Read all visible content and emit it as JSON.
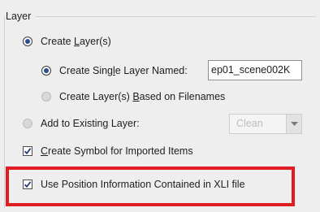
{
  "group": {
    "title": "Layer"
  },
  "options": {
    "create_layers": {
      "label_pre": "Create ",
      "label_u": "L",
      "label_post": "ayer(s)",
      "checked": true
    },
    "single_layer": {
      "label_pre": "Create Sing",
      "label_u": "l",
      "label_post": "e Layer Named:",
      "checked": true,
      "value": "ep01_scene002K"
    },
    "based_on_filenames": {
      "label_pre": "Create Layer(s) ",
      "label_u": "B",
      "label_post": "ased on Filenames",
      "checked": false
    },
    "add_existing": {
      "label_pre": "Add to Existing Layer:",
      "checked": false,
      "selected": "Clean"
    },
    "create_symbol": {
      "label_u": "C",
      "label_post": "reate Symbol for Imported Items",
      "checked": true
    },
    "use_position": {
      "label": "Use Position Information Contained in XLI file",
      "checked": true
    }
  },
  "icons": {
    "dropdown": "chevron-down-icon",
    "check": "checkmark-icon"
  },
  "colors": {
    "highlight": "#e01b22",
    "radio_dot": "#2a4f8f"
  }
}
